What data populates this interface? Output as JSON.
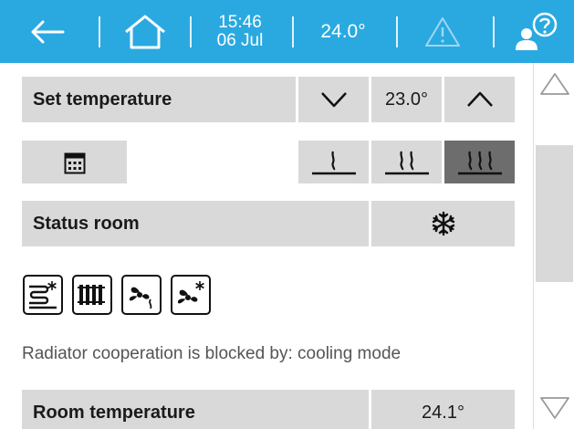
{
  "header": {
    "back_icon": "arrow-left-icon",
    "home_icon": "home-icon",
    "time": "15:46",
    "date": "06 Jul",
    "temperature": "24.0°",
    "warning_icon": "warning-icon",
    "user_help_icon": "user-help-icon",
    "background_color": "#2aa9e1"
  },
  "set_temperature": {
    "label": "Set temperature",
    "decrease_icon": "chevron-down-icon",
    "value": "23.0°",
    "increase_icon": "chevron-up-icon"
  },
  "schedule": {
    "calendar_icon": "calendar-icon",
    "levels": [
      {
        "icon": "heat-level-1-icon",
        "active": false
      },
      {
        "icon": "heat-level-2-icon",
        "active": false
      },
      {
        "icon": "heat-level-3-icon",
        "active": true
      }
    ]
  },
  "status_room": {
    "label": "Status room",
    "mode_icon": "snowflake-icon"
  },
  "mode_icons": [
    "floor-cooling-icon",
    "radiator-icon",
    "fan-heating-icon",
    "fan-cooling-icon"
  ],
  "block_message": "Radiator cooperation is blocked by: cooling mode",
  "room_temperature": {
    "label": "Room temperature",
    "value": "24.1°"
  },
  "colors": {
    "row_background": "#d9d9d9",
    "active_level": "#6d6d6d"
  }
}
